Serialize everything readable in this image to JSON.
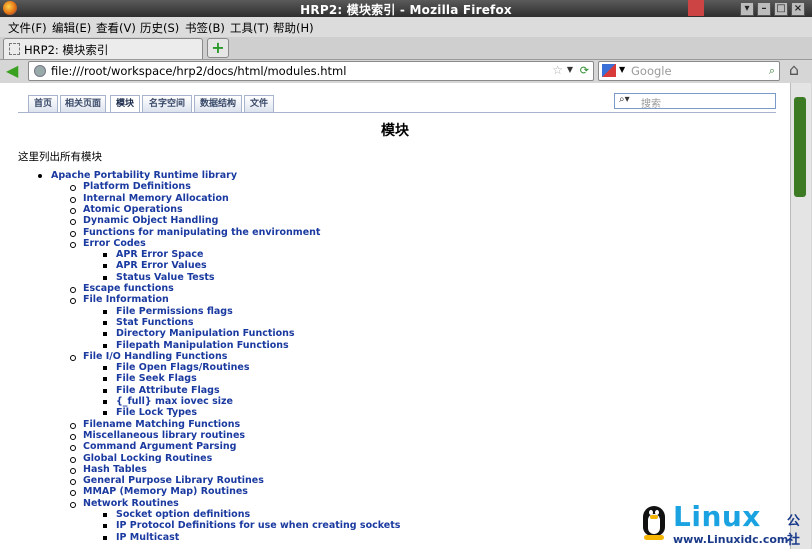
{
  "window": {
    "title": "HRP2: 模块索引 - Mozilla Firefox"
  },
  "menu": [
    "文件(F)",
    "编辑(E)",
    "查看(V)",
    "历史(S)",
    "书签(B)",
    "工具(T)",
    "帮助(H)"
  ],
  "browser_tab": {
    "label": "HRP2: 模块索引"
  },
  "address": {
    "url": "file:///root/workspace/hrp2/docs/html/modules.html"
  },
  "search": {
    "placeholder": "Google"
  },
  "doc_tabs": [
    "首页",
    "相关页面",
    "模块",
    "名字空间",
    "数据结构",
    "文件"
  ],
  "doc_search": {
    "placeholder": "搜索"
  },
  "page": {
    "title": "模块",
    "intro": "这里列出所有模块"
  },
  "tree": [
    {
      "level": 1,
      "text": "Apache Portability Runtime library"
    },
    {
      "level": 2,
      "text": "Platform Definitions"
    },
    {
      "level": 2,
      "text": "Internal Memory Allocation"
    },
    {
      "level": 2,
      "text": "Atomic Operations"
    },
    {
      "level": 2,
      "text": "Dynamic Object Handling"
    },
    {
      "level": 2,
      "text": "Functions for manipulating the environment"
    },
    {
      "level": 2,
      "text": "Error Codes"
    },
    {
      "level": 3,
      "text": "APR Error Space"
    },
    {
      "level": 3,
      "text": "APR Error Values"
    },
    {
      "level": 3,
      "text": "Status Value Tests"
    },
    {
      "level": 2,
      "text": "Escape functions"
    },
    {
      "level": 2,
      "text": "File Information"
    },
    {
      "level": 3,
      "text": "File Permissions flags"
    },
    {
      "level": 3,
      "text": "Stat Functions"
    },
    {
      "level": 3,
      "text": "Directory Manipulation Functions"
    },
    {
      "level": 3,
      "text": "Filepath Manipulation Functions"
    },
    {
      "level": 2,
      "text": "File I/O Handling Functions"
    },
    {
      "level": 3,
      "text": "File Open Flags/Routines"
    },
    {
      "level": 3,
      "text": "File Seek Flags"
    },
    {
      "level": 3,
      "text": "File Attribute Flags"
    },
    {
      "level": 3,
      "text": "{_full} max iovec size"
    },
    {
      "level": 3,
      "text": "File Lock Types"
    },
    {
      "level": 2,
      "text": "Filename Matching Functions"
    },
    {
      "level": 2,
      "text": "Miscellaneous library routines"
    },
    {
      "level": 2,
      "text": "Command Argument Parsing"
    },
    {
      "level": 2,
      "text": "Global Locking Routines"
    },
    {
      "level": 2,
      "text": "Hash Tables"
    },
    {
      "level": 2,
      "text": "General Purpose Library Routines"
    },
    {
      "level": 2,
      "text": "MMAP (Memory Map) Routines"
    },
    {
      "level": 2,
      "text": "Network Routines"
    },
    {
      "level": 3,
      "text": "Socket option definitions"
    },
    {
      "level": 3,
      "text": "IP Protocol Definitions for use when creating sockets"
    },
    {
      "level": 3,
      "text": "IP Multicast"
    }
  ],
  "watermark": {
    "brand": "Linux",
    "suffix": "公社",
    "url": "www.Linuxidc.com"
  }
}
